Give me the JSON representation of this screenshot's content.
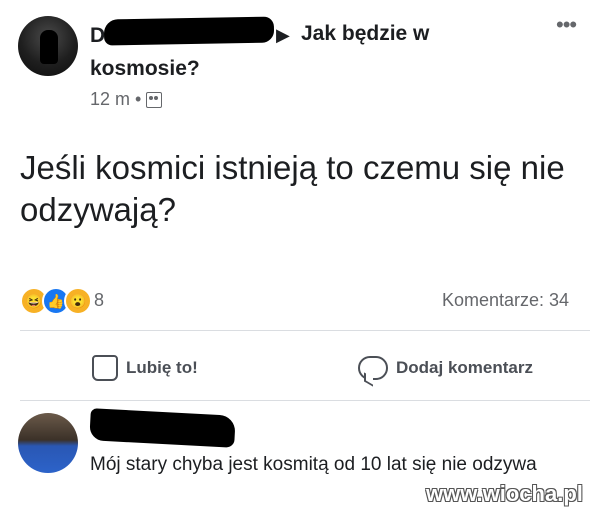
{
  "post": {
    "author_visible": "D",
    "arrow": "▶",
    "group_line1": "Jak będzie w",
    "group_line2": "kosmosie?",
    "time": "12 m",
    "dot": "•",
    "more_label": "•••",
    "text": "Jeśli kosmici istnieją to czemu się nie odzywają?",
    "reaction_count": "8",
    "comments_label": "Komentarze: 34",
    "like_label": "Lubię to!",
    "comment_label": "Dodaj komentarz"
  },
  "icons": {
    "audience": "group-icon",
    "like": "thumbs-up-icon",
    "comment": "comment-bubble-icon",
    "reactions": [
      "haha-icon",
      "like-reaction-icon",
      "wow-icon"
    ]
  },
  "comment": {
    "text": "Mój stary chyba jest kosmitą od 10 lat się nie odzywa"
  },
  "watermark": "www.wiocha.pl",
  "colors": {
    "text": "#1c1e21",
    "muted": "#65676b",
    "like_blue": "#1877f2",
    "reaction_yellow": "#f7b125"
  }
}
